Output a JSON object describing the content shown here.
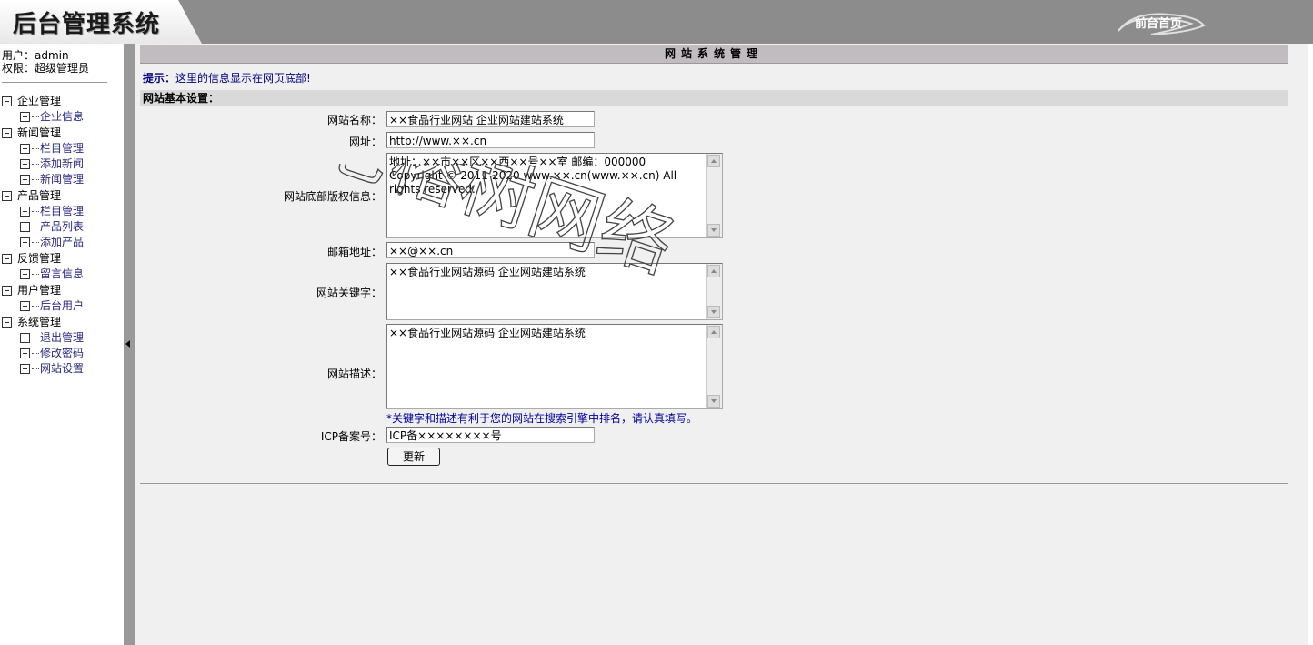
{
  "header": {
    "app_title": "后台管理系统",
    "front_page_link": "前台首页"
  },
  "user": {
    "username_line": "用户：admin",
    "role_line": "权限：超级管理员"
  },
  "sidebar": {
    "groups": [
      {
        "title": "企业管理",
        "items": [
          "企业信息"
        ]
      },
      {
        "title": "新闻管理",
        "items": [
          "栏目管理",
          "添加新闻",
          "新闻管理"
        ]
      },
      {
        "title": "产品管理",
        "items": [
          "栏目管理",
          "产品列表",
          "添加产品"
        ]
      },
      {
        "title": "反馈管理",
        "items": [
          "留言信息"
        ]
      },
      {
        "title": "用户管理",
        "items": [
          "后台用户"
        ]
      },
      {
        "title": "系统管理",
        "items": [
          "退出管理",
          "修改密码",
          "网站设置"
        ]
      }
    ]
  },
  "main": {
    "title": "网站系统管理",
    "hint_label": "提示：",
    "hint_text": "这里的信息显示在网页底部!",
    "section_title": "网站基本设置：",
    "fields": {
      "site_name_label": "网站名称：",
      "site_name_value": "××食品行业网站 企业网站建站系统",
      "url_label": "网址：",
      "url_value": "http://www.××.cn",
      "copyright_label": "网站底部版权信息：",
      "copyright_value_1": "地址：××市××区××西××号××室   邮编：000000",
      "copyright_value_2": "Copyright © 2011-2020 www.××.cn(www.××.cn) All rights reserved.",
      "email_label": "邮箱地址：",
      "email_value": "××@××.cn",
      "keywords_label": "网站关键字：",
      "keywords_value": "××食品行业网站源码 企业网站建站系统",
      "description_label": "网站描述：",
      "description_value": "××食品行业网站源码 企业网站建站系统",
      "note": "*关键字和描述有利于您的网站在搜索引擎中排名，请认真填写。",
      "icp_label": "ICP备案号：",
      "icp_value": "ICP备××××××××号"
    },
    "submit_label": "更新"
  },
  "watermark": "老榕树网络"
}
